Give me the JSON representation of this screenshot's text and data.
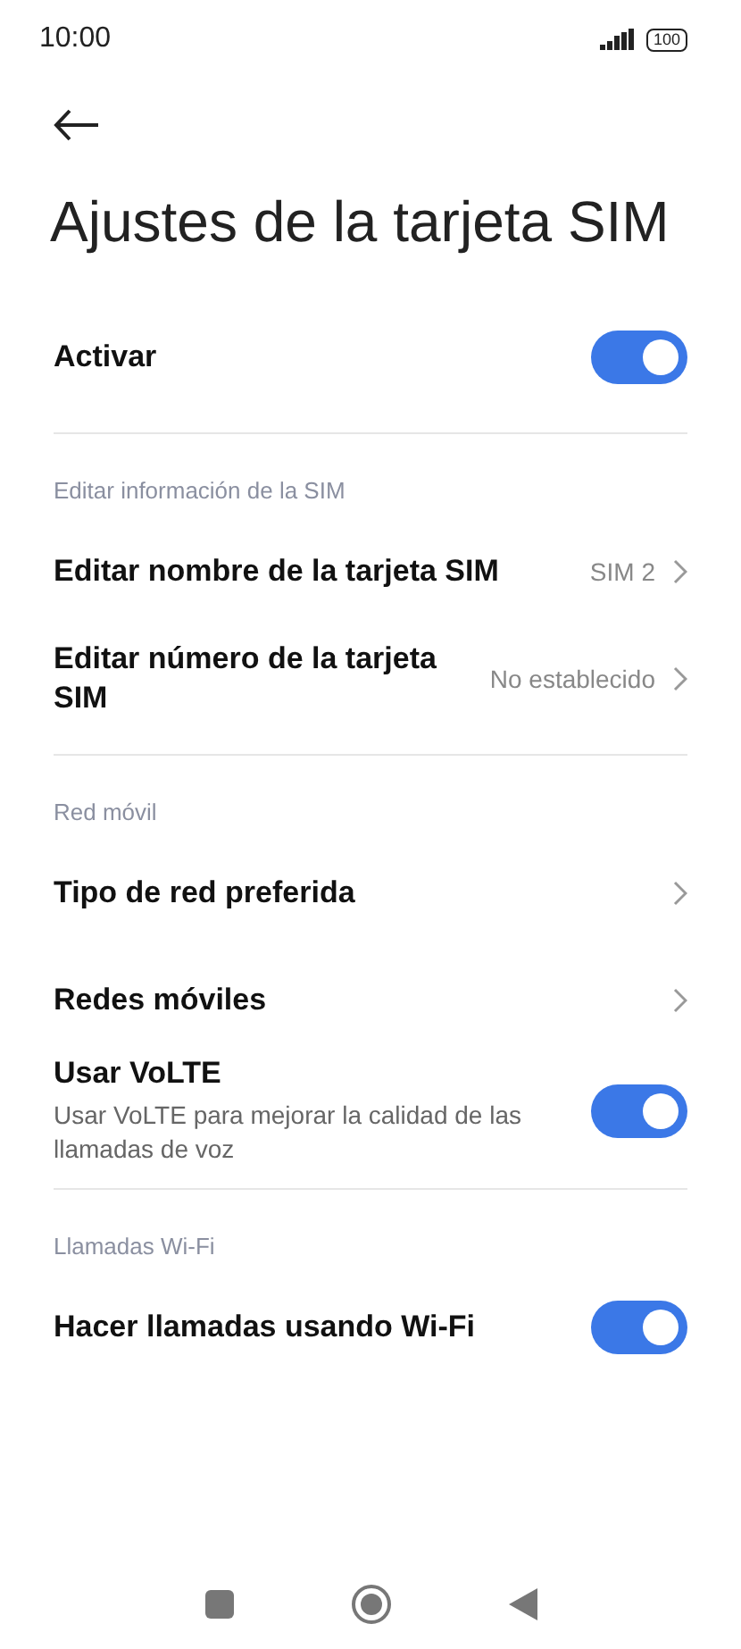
{
  "status_bar": {
    "time": "10:00",
    "battery": "100"
  },
  "title": "Ajustes de la tarjeta SIM",
  "sections": [
    {
      "items": [
        {
          "kind": "toggle",
          "label": "Activar",
          "on": true
        }
      ]
    },
    {
      "header": "Editar información de la SIM",
      "items": [
        {
          "kind": "link",
          "label": "Editar nombre de la tarjeta SIM",
          "value": "SIM 2"
        },
        {
          "kind": "link",
          "label": "Editar número de la tarjeta SIM",
          "value": "No establecido"
        }
      ]
    },
    {
      "header": "Red móvil",
      "items": [
        {
          "kind": "link",
          "label": "Tipo de red preferida"
        },
        {
          "kind": "link",
          "label": "Redes móviles"
        },
        {
          "kind": "toggle",
          "label": "Usar VoLTE",
          "description": "Usar VoLTE para mejorar la calidad de las llamadas de voz",
          "on": true
        }
      ]
    },
    {
      "header": "Llamadas Wi-Fi",
      "items": [
        {
          "kind": "toggle",
          "label": "Hacer llamadas usando Wi-Fi",
          "on": true
        }
      ]
    }
  ]
}
